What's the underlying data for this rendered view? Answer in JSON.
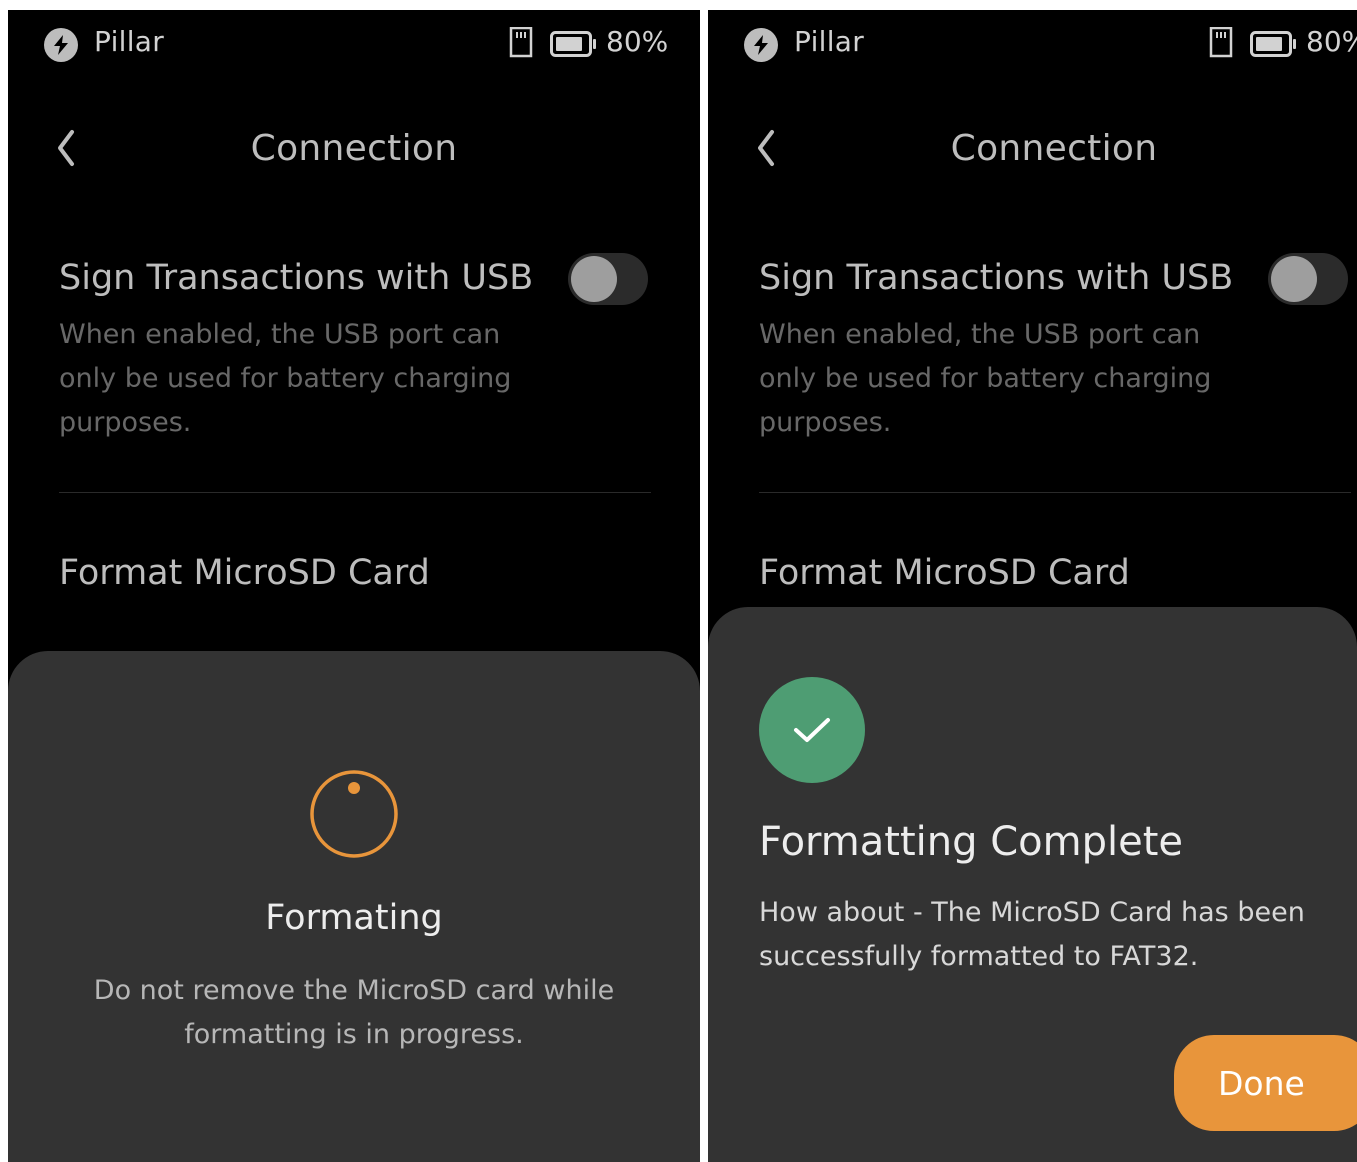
{
  "screens": [
    {
      "status_bar": {
        "brand_name": "Pillar",
        "battery": "80%"
      },
      "header": {
        "title": "Connection"
      },
      "settings": {
        "usb": {
          "title": "Sign Transactions with USB",
          "description": "When enabled, the USB port can only be used for battery charging purposes.",
          "enabled": false
        },
        "format_label": "Format MicroSD Card"
      },
      "sheet": {
        "title": "Formating",
        "description": "Do not remove the MicroSD card while formatting is in progress."
      }
    },
    {
      "status_bar": {
        "brand_name": "Pillar",
        "battery": "80%"
      },
      "header": {
        "title": "Connection"
      },
      "settings": {
        "usb": {
          "title": "Sign Transactions with USB",
          "description": "When enabled, the USB port can only be used for battery charging purposes.",
          "enabled": false
        },
        "format_label": "Format MicroSD Card"
      },
      "sheet": {
        "title": "Formatting Complete",
        "description": "How about - The MicroSD Card has been successfully formatted to FAT32.",
        "done_label": "Done"
      }
    }
  ],
  "icons": {
    "brand": "bolt-icon",
    "sd_card": "sd-card-icon",
    "battery": "battery-icon",
    "back": "chevron-left-icon",
    "spinner": "spinner-icon",
    "success": "check-icon"
  },
  "colors": {
    "accent_orange": "#e8953b",
    "success_green": "#4e9d73",
    "sheet_background": "#333333",
    "screen_background": "#000000"
  }
}
